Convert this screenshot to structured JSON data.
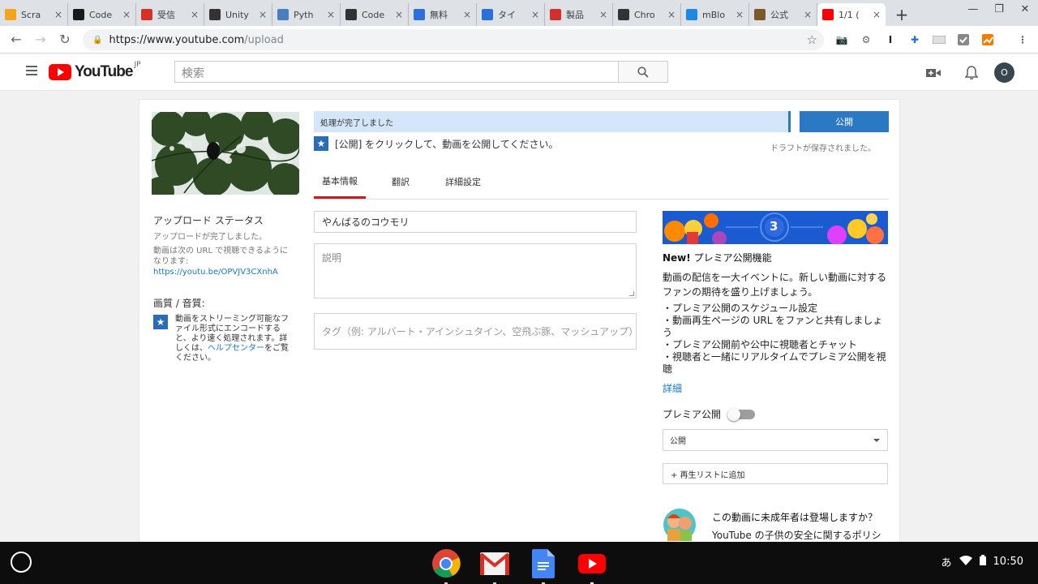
{
  "browser": {
    "tabs": [
      {
        "label": "Scra",
        "icon": "scratch-icon",
        "color": "#f7a41d"
      },
      {
        "label": "Code",
        "icon": "code-grid-icon",
        "color": "#1a1a1a"
      },
      {
        "label": "受信",
        "icon": "gmail-icon",
        "color": "#d93025"
      },
      {
        "label": "Unity",
        "icon": "unity-icon",
        "color": "#333333"
      },
      {
        "label": "Pyth",
        "icon": "python-icon",
        "color": "#4a7fbf"
      },
      {
        "label": "Code",
        "icon": "info-icon",
        "color": "#333333"
      },
      {
        "label": "無料",
        "icon": "stripes-icon",
        "color": "#2a6fdb"
      },
      {
        "label": "タイ",
        "icon": "stripes-icon",
        "color": "#2a6fdb"
      },
      {
        "label": "製品",
        "icon": "puzzle-icon",
        "color": "#d32f2f"
      },
      {
        "label": "Chro",
        "icon": "book-icon",
        "color": "#333333"
      },
      {
        "label": "mBlo",
        "icon": "mblock-icon",
        "color": "#1e88e5"
      },
      {
        "label": "公式",
        "icon": "cube-icon",
        "color": "#7a5a2b"
      },
      {
        "label": "1/1 (",
        "icon": "youtube-tab-icon",
        "color": "#ff0000",
        "active": true
      }
    ],
    "url_host": "https://www.youtube.com",
    "url_path": "/upload"
  },
  "yt_header": {
    "logo_word": "YouTube",
    "region": "JP",
    "search_placeholder": "検索",
    "avatar_letter": "O"
  },
  "upload": {
    "progress_text": "処理が完了しました",
    "publish_label": "公開",
    "hint_text": "[公開] をクリックして、動画を公開してください。",
    "draft_saved": "ドラフトが保存されました。",
    "tabs": [
      "基本情報",
      "翻訳",
      "詳細設定"
    ],
    "title_value": "やんばるのコウモリ",
    "description_placeholder": "説明",
    "tags_placeholder": "タグ（例: アルバート・アインシュタイン、空飛ぶ豚、マッシュアップ）"
  },
  "status": {
    "heading": "アップロード ステータス",
    "complete": "アップロードが完了しました。",
    "url_intro": "動画は次の URL で視聴できるようになります:",
    "url": "https://youtu.be/OPVJV3CXnhA",
    "quality_heading": "画質 / 音質:",
    "quality_text": "動画をストリーミング可能なファイル形式にエンコードすると、より速く処理されます。詳しくは、",
    "help_link": "ヘルプセンター",
    "quality_tail": "をご覧ください。"
  },
  "premiere": {
    "banner_number": "3",
    "new_label": "New!",
    "title": "プレミア公開機能",
    "body": "動画の配信を一大イベントに。新しい動画に対するファンの期待を盛り上げましょう。",
    "bullets": [
      "・プレミア公開のスケジュール設定",
      "・動画再生ページの URL をファンと共有しましょう",
      "・プレミア公開前や公中に視聴者とチャット",
      "・視聴者と一緒にリアルタイムでプレミア公開を視聴"
    ],
    "more": "詳細",
    "toggle_label": "プレミア公開",
    "visibility": "公開",
    "playlist": "+ 再生リストに追加",
    "kids_question": "この動画に未成年者は登場しますか？",
    "kids_body": "YouTube の子供の安全に関するポリシーに従っていることと、適用される可"
  },
  "shelf": {
    "ime": "あ",
    "time": "10:50"
  }
}
